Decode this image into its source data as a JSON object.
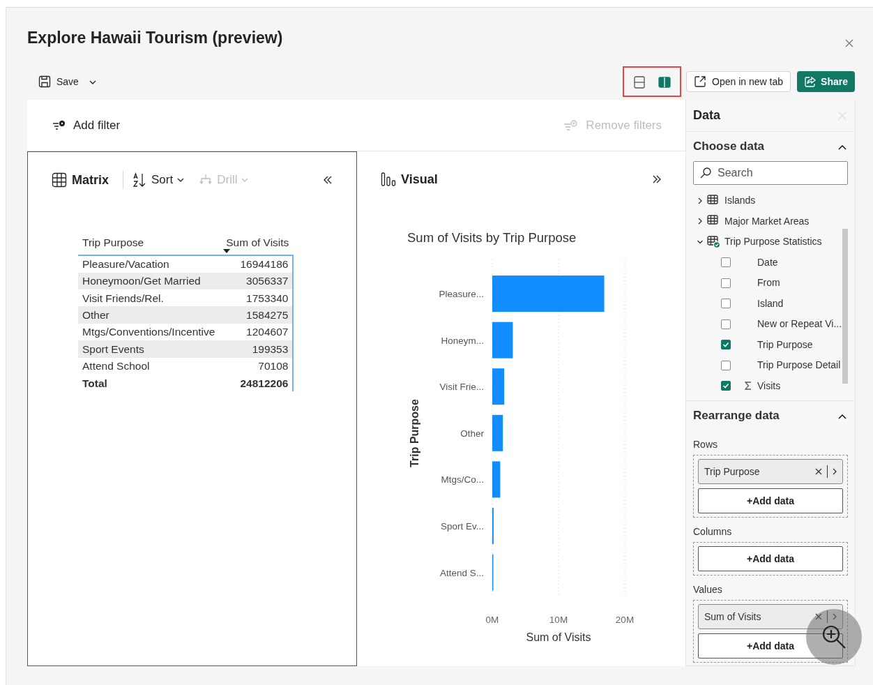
{
  "dialog": {
    "title": "Explore Hawaii Tourism (preview)"
  },
  "toolbar": {
    "save": "Save",
    "layout_toggles": [
      {
        "kind": "stacked",
        "selected": false
      },
      {
        "kind": "side",
        "selected": true
      }
    ],
    "open_new_tab": "Open in new tab",
    "share": "Share"
  },
  "filter_bar": {
    "add_filter": "Add filter",
    "remove_filters": {
      "label": "Remove filters",
      "disabled": true
    }
  },
  "matrix_pane": {
    "title": "Matrix",
    "sort": "Sort",
    "drill": {
      "label": "Drill",
      "disabled": true
    },
    "table": {
      "columns": [
        {
          "label": "Trip Purpose"
        },
        {
          "label": "Sum of Visits",
          "sorted": true
        }
      ],
      "rows": [
        {
          "purpose": "Pleasure/Vacation",
          "visits": "16944186"
        },
        {
          "purpose": "Honeymoon/Get Married",
          "visits": "3056337"
        },
        {
          "purpose": "Visit Friends/Rel.",
          "visits": "1753340"
        },
        {
          "purpose": "Other",
          "visits": "1584275"
        },
        {
          "purpose": "Mtgs/Conventions/Incentive",
          "visits": "1204607"
        },
        {
          "purpose": "Sport Events",
          "visits": "199353"
        },
        {
          "purpose": "Attend School",
          "visits": "70108"
        }
      ],
      "total": {
        "label": "Total",
        "value": "24812206"
      }
    }
  },
  "visual_pane": {
    "title": "Visual",
    "chart_data": {
      "type": "bar",
      "orientation": "horizontal",
      "title": "Sum of Visits by Trip Purpose",
      "xlabel": "Sum of Visits",
      "ylabel": "Trip Purpose",
      "categories": [
        "Pleasure...",
        "Honeym...",
        "Visit Frie...",
        "Other",
        "Mtgs/Co...",
        "Sport Ev...",
        "Attend S..."
      ],
      "series": [
        {
          "color": "#118dff",
          "values": [
            16900000,
            3100000,
            1800000,
            1600000,
            1200000,
            200000,
            70000
          ]
        }
      ],
      "xlim": [
        0,
        20000000
      ],
      "xticks": [
        {
          "value": 0,
          "label": "0M"
        },
        {
          "value": 10000000,
          "label": "10M"
        },
        {
          "value": 20000000,
          "label": "20M"
        }
      ]
    }
  },
  "data_pane": {
    "title": "Data",
    "choose_data": {
      "title": "Choose data",
      "expanded": true,
      "search_placeholder": "Search",
      "tree": [
        {
          "label": "Islands",
          "expanded": false,
          "in_use": false
        },
        {
          "label": "Major Market Areas",
          "expanded": false,
          "in_use": false
        },
        {
          "label": "Trip Purpose Statistics",
          "expanded": true,
          "in_use": true,
          "children": [
            {
              "label": "Date",
              "kind": "field",
              "checked": false
            },
            {
              "label": "From",
              "kind": "field",
              "checked": false
            },
            {
              "label": "Island",
              "kind": "field",
              "checked": false
            },
            {
              "label": "New or Repeat Vi...",
              "kind": "field",
              "checked": false
            },
            {
              "label": "Trip Purpose",
              "kind": "field",
              "checked": true
            },
            {
              "label": "Trip Purpose Detail",
              "kind": "field",
              "checked": false
            },
            {
              "label": "Visits",
              "kind": "measure",
              "checked": true
            }
          ]
        }
      ]
    },
    "rearrange": {
      "title": "Rearrange data",
      "expanded": true,
      "wells": [
        {
          "label": "Rows",
          "fields": [
            "Trip Purpose"
          ],
          "add": "+Add data"
        },
        {
          "label": "Columns",
          "add": "+Add data"
        },
        {
          "label": "Values",
          "fields": [
            "Sum of Visits"
          ],
          "add": "+Add data"
        }
      ]
    }
  }
}
